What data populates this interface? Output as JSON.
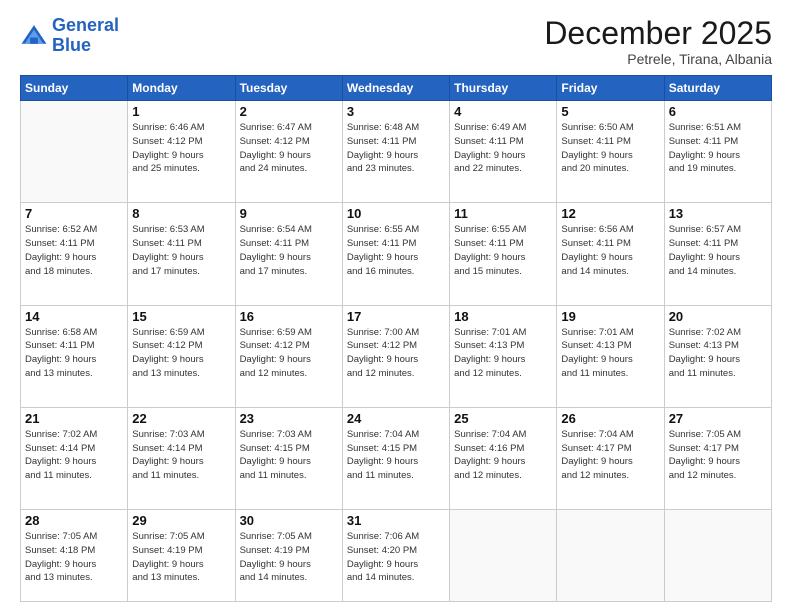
{
  "logo": {
    "line1": "General",
    "line2": "Blue"
  },
  "title": "December 2025",
  "subtitle": "Petrele, Tirana, Albania",
  "days_of_week": [
    "Sunday",
    "Monday",
    "Tuesday",
    "Wednesday",
    "Thursday",
    "Friday",
    "Saturday"
  ],
  "weeks": [
    [
      {
        "day": "",
        "info": ""
      },
      {
        "day": "1",
        "info": "Sunrise: 6:46 AM\nSunset: 4:12 PM\nDaylight: 9 hours\nand 25 minutes."
      },
      {
        "day": "2",
        "info": "Sunrise: 6:47 AM\nSunset: 4:12 PM\nDaylight: 9 hours\nand 24 minutes."
      },
      {
        "day": "3",
        "info": "Sunrise: 6:48 AM\nSunset: 4:11 PM\nDaylight: 9 hours\nand 23 minutes."
      },
      {
        "day": "4",
        "info": "Sunrise: 6:49 AM\nSunset: 4:11 PM\nDaylight: 9 hours\nand 22 minutes."
      },
      {
        "day": "5",
        "info": "Sunrise: 6:50 AM\nSunset: 4:11 PM\nDaylight: 9 hours\nand 20 minutes."
      },
      {
        "day": "6",
        "info": "Sunrise: 6:51 AM\nSunset: 4:11 PM\nDaylight: 9 hours\nand 19 minutes."
      }
    ],
    [
      {
        "day": "7",
        "info": "Sunrise: 6:52 AM\nSunset: 4:11 PM\nDaylight: 9 hours\nand 18 minutes."
      },
      {
        "day": "8",
        "info": "Sunrise: 6:53 AM\nSunset: 4:11 PM\nDaylight: 9 hours\nand 17 minutes."
      },
      {
        "day": "9",
        "info": "Sunrise: 6:54 AM\nSunset: 4:11 PM\nDaylight: 9 hours\nand 17 minutes."
      },
      {
        "day": "10",
        "info": "Sunrise: 6:55 AM\nSunset: 4:11 PM\nDaylight: 9 hours\nand 16 minutes."
      },
      {
        "day": "11",
        "info": "Sunrise: 6:55 AM\nSunset: 4:11 PM\nDaylight: 9 hours\nand 15 minutes."
      },
      {
        "day": "12",
        "info": "Sunrise: 6:56 AM\nSunset: 4:11 PM\nDaylight: 9 hours\nand 14 minutes."
      },
      {
        "day": "13",
        "info": "Sunrise: 6:57 AM\nSunset: 4:11 PM\nDaylight: 9 hours\nand 14 minutes."
      }
    ],
    [
      {
        "day": "14",
        "info": "Sunrise: 6:58 AM\nSunset: 4:11 PM\nDaylight: 9 hours\nand 13 minutes."
      },
      {
        "day": "15",
        "info": "Sunrise: 6:59 AM\nSunset: 4:12 PM\nDaylight: 9 hours\nand 13 minutes."
      },
      {
        "day": "16",
        "info": "Sunrise: 6:59 AM\nSunset: 4:12 PM\nDaylight: 9 hours\nand 12 minutes."
      },
      {
        "day": "17",
        "info": "Sunrise: 7:00 AM\nSunset: 4:12 PM\nDaylight: 9 hours\nand 12 minutes."
      },
      {
        "day": "18",
        "info": "Sunrise: 7:01 AM\nSunset: 4:13 PM\nDaylight: 9 hours\nand 12 minutes."
      },
      {
        "day": "19",
        "info": "Sunrise: 7:01 AM\nSunset: 4:13 PM\nDaylight: 9 hours\nand 11 minutes."
      },
      {
        "day": "20",
        "info": "Sunrise: 7:02 AM\nSunset: 4:13 PM\nDaylight: 9 hours\nand 11 minutes."
      }
    ],
    [
      {
        "day": "21",
        "info": "Sunrise: 7:02 AM\nSunset: 4:14 PM\nDaylight: 9 hours\nand 11 minutes."
      },
      {
        "day": "22",
        "info": "Sunrise: 7:03 AM\nSunset: 4:14 PM\nDaylight: 9 hours\nand 11 minutes."
      },
      {
        "day": "23",
        "info": "Sunrise: 7:03 AM\nSunset: 4:15 PM\nDaylight: 9 hours\nand 11 minutes."
      },
      {
        "day": "24",
        "info": "Sunrise: 7:04 AM\nSunset: 4:15 PM\nDaylight: 9 hours\nand 11 minutes."
      },
      {
        "day": "25",
        "info": "Sunrise: 7:04 AM\nSunset: 4:16 PM\nDaylight: 9 hours\nand 12 minutes."
      },
      {
        "day": "26",
        "info": "Sunrise: 7:04 AM\nSunset: 4:17 PM\nDaylight: 9 hours\nand 12 minutes."
      },
      {
        "day": "27",
        "info": "Sunrise: 7:05 AM\nSunset: 4:17 PM\nDaylight: 9 hours\nand 12 minutes."
      }
    ],
    [
      {
        "day": "28",
        "info": "Sunrise: 7:05 AM\nSunset: 4:18 PM\nDaylight: 9 hours\nand 13 minutes."
      },
      {
        "day": "29",
        "info": "Sunrise: 7:05 AM\nSunset: 4:19 PM\nDaylight: 9 hours\nand 13 minutes."
      },
      {
        "day": "30",
        "info": "Sunrise: 7:05 AM\nSunset: 4:19 PM\nDaylight: 9 hours\nand 14 minutes."
      },
      {
        "day": "31",
        "info": "Sunrise: 7:06 AM\nSunset: 4:20 PM\nDaylight: 9 hours\nand 14 minutes."
      },
      {
        "day": "",
        "info": ""
      },
      {
        "day": "",
        "info": ""
      },
      {
        "day": "",
        "info": ""
      }
    ]
  ]
}
